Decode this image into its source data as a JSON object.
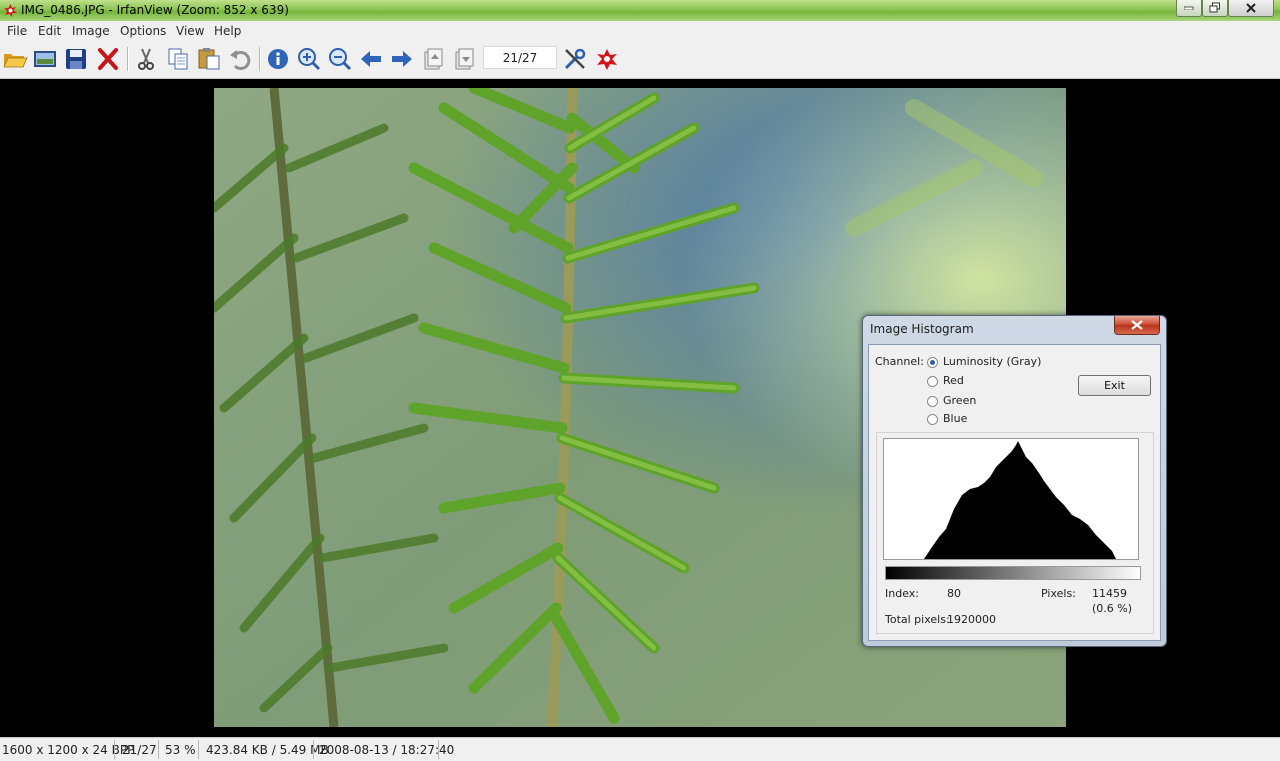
{
  "window": {
    "title": "IMG_0486.JPG - IrfanView (Zoom: 852 x 639)"
  },
  "menu": [
    "File",
    "Edit",
    "Image",
    "Options",
    "View",
    "Help"
  ],
  "toolbar": {
    "page_indicator": "21/27",
    "icons": [
      "open-folder",
      "thumbnails",
      "save",
      "delete",
      "cut",
      "copy",
      "paste",
      "undo",
      "info",
      "zoom-in",
      "zoom-out",
      "previous",
      "next",
      "previous-page",
      "next-page",
      "settings",
      "irfanview-logo"
    ]
  },
  "histogram": {
    "title": "Image Histogram",
    "channel_label": "Channel:",
    "channels": [
      "Luminosity (Gray)",
      "Red",
      "Green",
      "Blue"
    ],
    "selected_channel": "Luminosity (Gray)",
    "exit_label": "Exit",
    "index_label": "Index:",
    "index_value": "80",
    "pixels_label": "Pixels:",
    "pixels_value": "11459",
    "pixels_percent": "(0.6 %)",
    "total_label": "Total pixels:",
    "total_value": "1920000"
  },
  "status": {
    "dimensions": "1600 x 1200 x 24 BPP",
    "position": "21/27",
    "zoom": "53 %",
    "size": "423.84 KB / 5.49 MB",
    "datetime": "2008-08-13 / 18:27:40"
  },
  "colors": {
    "title_bar": "#8cc653",
    "histogram_fill": "#000000",
    "photo_background": "#6f8f5f"
  }
}
